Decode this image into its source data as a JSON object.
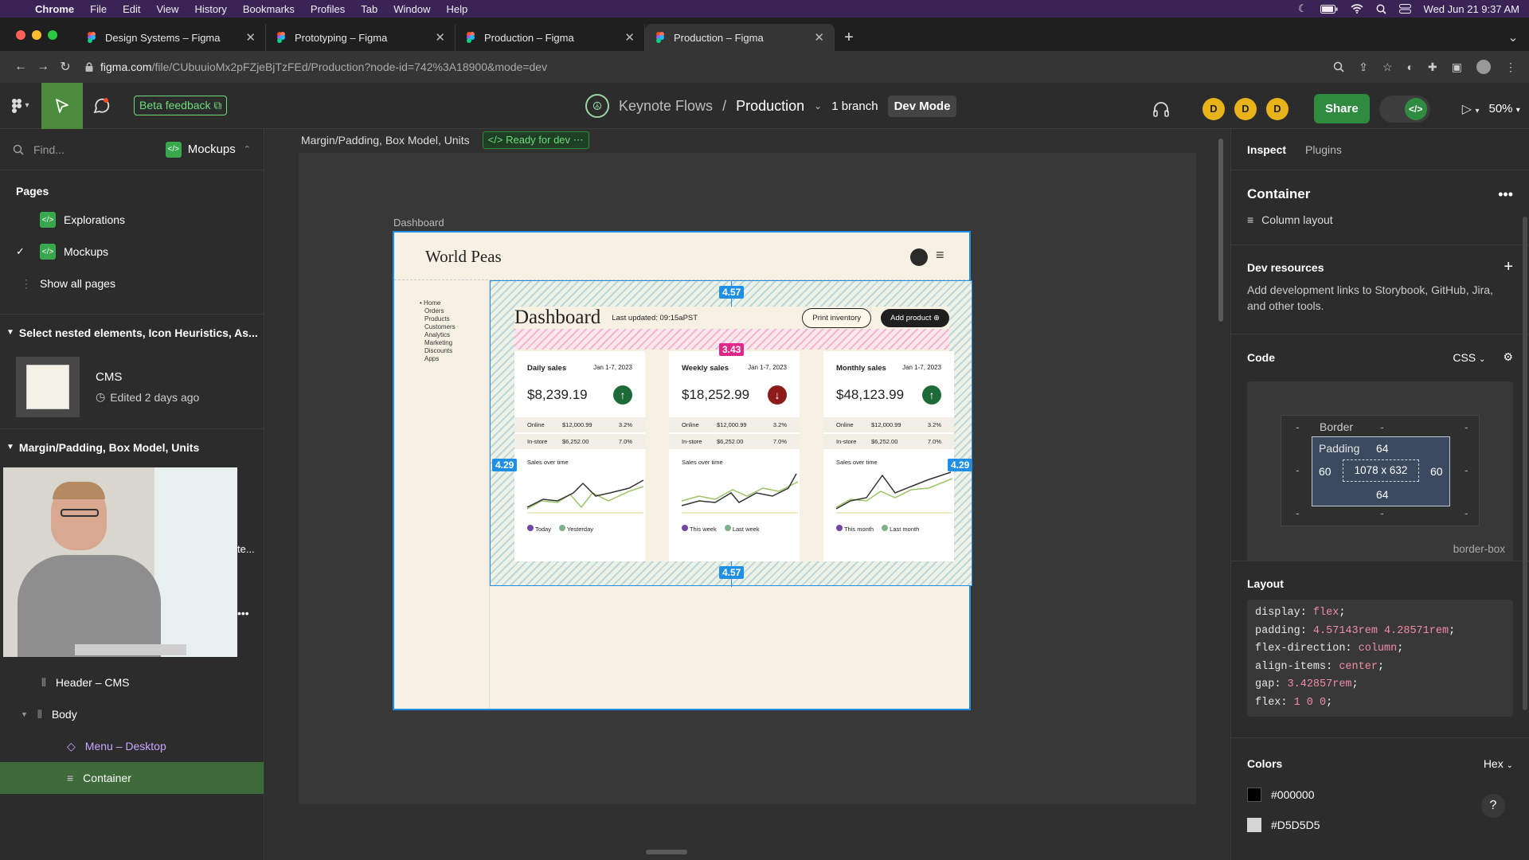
{
  "menubar": {
    "app": "Chrome",
    "items": [
      "File",
      "Edit",
      "View",
      "History",
      "Bookmarks",
      "Profiles",
      "Tab",
      "Window",
      "Help"
    ],
    "clock": "Wed Jun 21 9:37 AM"
  },
  "tabs": [
    {
      "label": "Design Systems – Figma"
    },
    {
      "label": "Prototyping – Figma"
    },
    {
      "label": "Production – Figma"
    },
    {
      "label": "Production – Figma"
    }
  ],
  "address": {
    "domain": "figma.com",
    "path": "/file/CUbuuioMx2pFZjeBjTzFEd/Production?node-id=742%3A18900&mode=dev"
  },
  "toolbar": {
    "beta": "Beta feedback",
    "project": "Keynote Flows",
    "sep": "/",
    "file": "Production",
    "branch": "1 branch",
    "devmode": "Dev Mode",
    "avatars": [
      "D",
      "D",
      "D"
    ],
    "share": "Share",
    "zoom": "50%"
  },
  "left": {
    "find": "Find...",
    "page_selector": "Mockups",
    "pages_title": "Pages",
    "pages": [
      "Explorations",
      "Mockups"
    ],
    "show_all": "Show all pages",
    "section1": "Select nested elements, Icon Heuristics, As...",
    "cms_title": "CMS",
    "cms_edited": "Edited 2 days ago",
    "section2": "Margin/Padding, Box Model, Units",
    "layers": [
      "Header – CMS",
      "Body",
      "Menu – Desktop",
      "Container"
    ]
  },
  "canvas": {
    "crumb": "Margin/Padding, Box Model, Units",
    "ready": "Ready for dev",
    "frame_label": "Dashboard",
    "brand": "World Peas",
    "nav": [
      "Home",
      "Orders",
      "Products",
      "Customers",
      "Analytics",
      "Marketing",
      "Discounts",
      "Apps"
    ],
    "dash_title": "Dashboard",
    "updated": "Last updated: 09:15aPST",
    "print_btn": "Print inventory",
    "add_btn": "Add product",
    "measures": {
      "top": "4.57",
      "gap": "3.43",
      "left": "4.29",
      "right": "4.29",
      "bottom": "4.57"
    },
    "cards": [
      {
        "title": "Daily sales",
        "dates": "Jan 1-7, 2023",
        "amount": "$8,239.19",
        "trend": "up",
        "online": "$12,000.99",
        "online_pct": "3.2%",
        "instore": "$6,252.00",
        "instore_pct": "7.0%",
        "chart_title": "Sales over time",
        "legend": [
          "Today",
          "Yesterday"
        ]
      },
      {
        "title": "Weekly sales",
        "dates": "Jan 1-7, 2023",
        "amount": "$18,252.99",
        "trend": "down",
        "online": "$12,000.99",
        "online_pct": "3.2%",
        "instore": "$6,252.00",
        "instore_pct": "7.0%",
        "chart_title": "Sales over time",
        "legend": [
          "This week",
          "Last week"
        ]
      },
      {
        "title": "Monthly sales",
        "dates": "Jan 1-7, 2023",
        "amount": "$48,123.99",
        "trend": "up",
        "online": "$12,000.99",
        "online_pct": "3.2%",
        "instore": "$6,252.00",
        "instore_pct": "7.0%",
        "chart_title": "Sales over time",
        "legend": [
          "This month",
          "Last month"
        ]
      }
    ],
    "row_online": "Online",
    "row_instore": "In-store"
  },
  "right": {
    "tabs": [
      "Inspect",
      "Plugins"
    ],
    "title": "Container",
    "layout_type": "Column layout",
    "dev_res_title": "Dev resources",
    "dev_res_text": "Add development links to Storybook, GitHub, Jira, and other tools.",
    "code_title": "Code",
    "code_lang": "CSS",
    "box": {
      "border": "Border",
      "dash": "-",
      "padding": "Padding",
      "pad_top": "64",
      "pad_left": "60",
      "pad_right": "60",
      "pad_bottom": "64",
      "size": "1078 x 632",
      "sizing": "border-box"
    },
    "layout_title": "Layout",
    "css": [
      {
        "p": "display",
        "v": "flex"
      },
      {
        "p": "padding",
        "v": "4.57143rem 4.28571rem"
      },
      {
        "p": "flex-direction",
        "v": "column"
      },
      {
        "p": "align-items",
        "v": "center"
      },
      {
        "p": "gap",
        "v": "3.42857rem"
      },
      {
        "p": "flex",
        "v": "1 0 0"
      }
    ],
    "colors_title": "Colors",
    "color_fmt": "Hex",
    "colors": [
      {
        "hex": "#000000"
      },
      {
        "hex": "#D5D5D5"
      }
    ],
    "help": "?"
  }
}
